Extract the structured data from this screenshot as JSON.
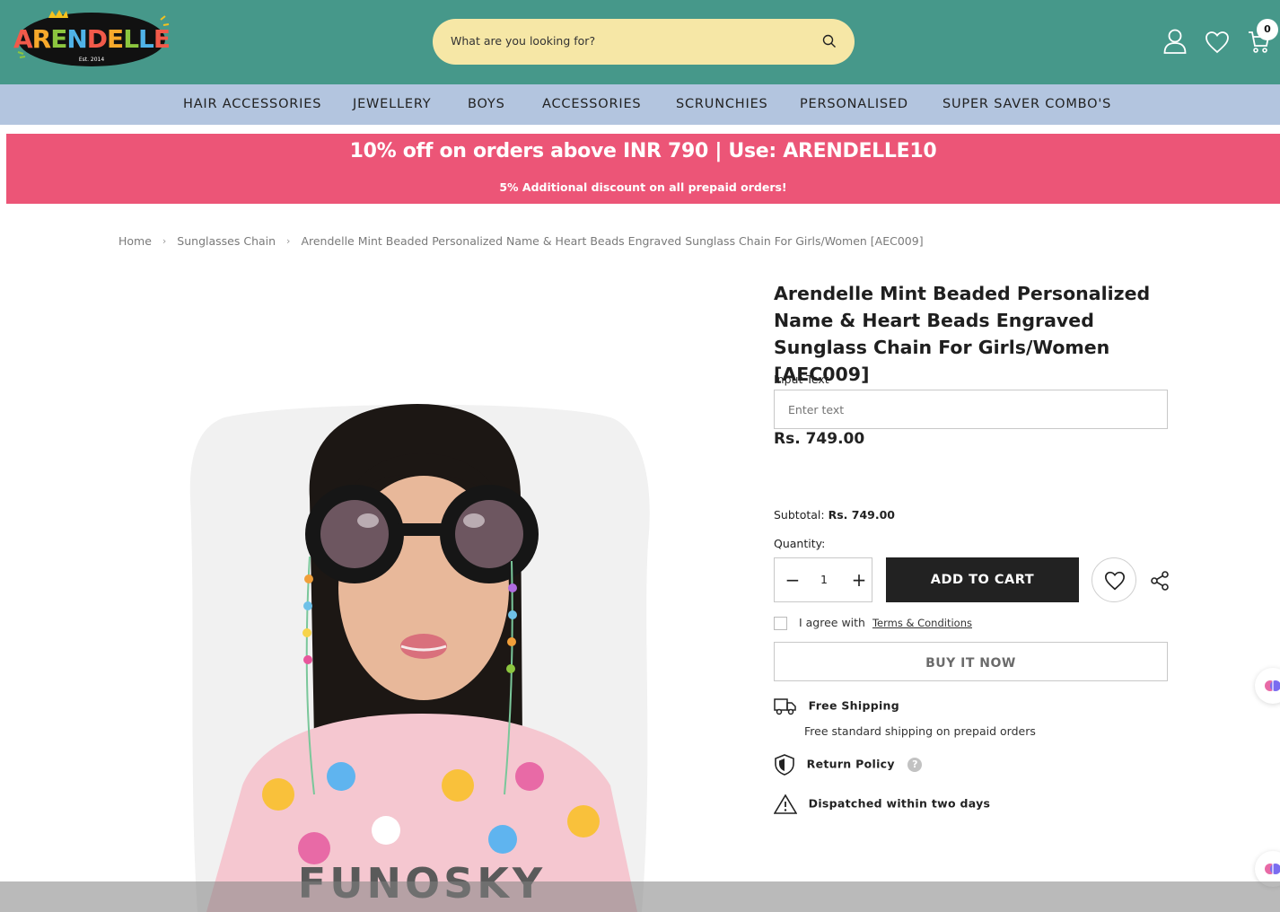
{
  "header": {
    "logo_text": "ARENDELLE",
    "logo_sub": "Est. 2014",
    "search_placeholder": "What are you looking for?",
    "cart_count": "0",
    "icons": [
      "user-icon",
      "heart-icon",
      "cart-icon",
      "search-icon"
    ]
  },
  "nav": {
    "items": [
      {
        "label": "HAIR ACCESSORIES"
      },
      {
        "label": "JEWELLERY"
      },
      {
        "label": "BOYS"
      },
      {
        "label": "ACCESSORIES"
      },
      {
        "label": "SCRUNCHIES"
      },
      {
        "label": "PERSONALISED"
      },
      {
        "label": "SUPER SAVER COMBO'S"
      }
    ]
  },
  "promo": {
    "title": "10% off on orders above INR 790 | Use: ARENDELLE10",
    "subtitle": "5% Additional discount on all prepaid orders!"
  },
  "breadcrumb": {
    "items": [
      "Home",
      "Sunglasses Chain",
      "Arendelle Mint Beaded Personalized Name & Heart Beads Engraved Sunglass Chain For Girls/Women [AEC009]"
    ]
  },
  "product": {
    "title": "Arendelle Mint Beaded Personalized Name & Heart Beads Engraved Sunglass Chain For Girls/Women [AEC009]",
    "input_label": "Input Text",
    "input_placeholder": "Enter text",
    "price": "Rs. 749.00",
    "subtotal_label": "Subtotal:",
    "subtotal_value": "Rs. 749.00",
    "quantity_label": "Quantity:",
    "quantity_value": "1",
    "add_to_cart": "ADD TO CART",
    "agree_text": "I agree with",
    "terms_link": "Terms & Conditions",
    "buy_now": "BUY IT NOW",
    "image_text": "FUNOSKY",
    "shipping_title": "Free Shipping",
    "shipping_sub": "Free standard shipping on prepaid orders",
    "return_policy": "Return Policy",
    "help_mark": "?",
    "dispatch": "Dispatched within two days"
  },
  "colors": {
    "header_bg": "#46988a",
    "search_bg": "#f6e7a6",
    "nav_bg": "#b3c5df",
    "promo_bg": "#ec5577",
    "button_dark": "#222222"
  }
}
